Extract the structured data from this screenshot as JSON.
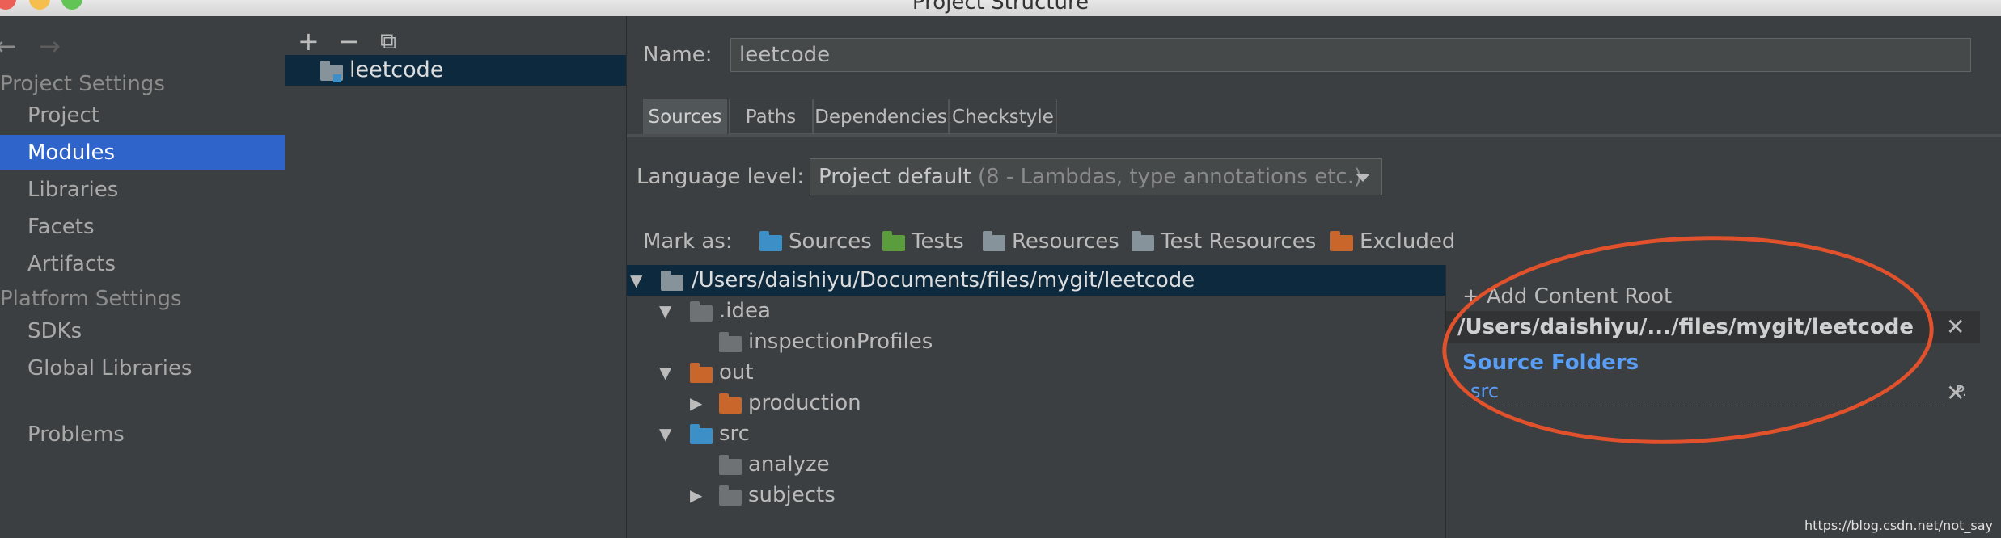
{
  "window": {
    "title": "Project Structure",
    "traffic_lights": [
      "#ec5f57",
      "#f5bf4f",
      "#61c454"
    ]
  },
  "nav": {
    "back": "←",
    "forward": "→",
    "project_settings_title": "Project Settings",
    "platform_settings_title": "Platform Settings",
    "items": {
      "project": "Project",
      "modules": "Modules",
      "libraries": "Libraries",
      "facets": "Facets",
      "artifacts": "Artifacts",
      "sdks": "SDKs",
      "global_libraries": "Global Libraries",
      "problems": "Problems"
    },
    "selected": "Modules"
  },
  "module_list": {
    "add": "+",
    "remove": "−",
    "copy": "⧉",
    "modules": [
      "leetcode"
    ]
  },
  "module_editor": {
    "name_label": "Name:",
    "name_value": "leetcode",
    "tabs": [
      "Sources",
      "Paths",
      "Dependencies",
      "Checkstyle"
    ],
    "active_tab": "Sources",
    "language_level_label": "Language level:",
    "language_level_value": "Project default",
    "language_level_hint": "(8 - Lambdas, type annotations etc.)",
    "mark_as_label": "Mark as:",
    "mark_as": [
      {
        "label": "Sources",
        "color": "#3d8fc7"
      },
      {
        "label": "Tests",
        "color": "#5b9c3c"
      },
      {
        "label": "Resources",
        "color": "#87939a"
      },
      {
        "label": "Test Resources",
        "color": "#87939a"
      },
      {
        "label": "Excluded",
        "color": "#c9662b"
      }
    ]
  },
  "tree": [
    {
      "label": "/Users/daishiyu/Documents/files/mygit/leetcode",
      "arrow": "▼",
      "color": "#87939a",
      "depth": 0,
      "selected": true
    },
    {
      "label": ".idea",
      "arrow": "▼",
      "color": "#6e7275",
      "depth": 1
    },
    {
      "label": "inspectionProfiles",
      "arrow": "",
      "color": "#6e7275",
      "depth": 2
    },
    {
      "label": "out",
      "arrow": "▼",
      "color": "#c9662b",
      "depth": 1
    },
    {
      "label": "production",
      "arrow": "▶",
      "color": "#c9662b",
      "depth": 2
    },
    {
      "label": "src",
      "arrow": "▼",
      "color": "#3d8fc7",
      "depth": 1
    },
    {
      "label": "analyze",
      "arrow": "",
      "color": "#6e7275",
      "depth": 2
    },
    {
      "label": "subjects",
      "arrow": "▶",
      "color": "#6e7275",
      "depth": 2
    }
  ],
  "content_root": {
    "add_label": "+ Add Content Root",
    "path": "/Users/daishiyu/.../files/mygit/leetcode",
    "close": "✕",
    "source_folders_title": "Source Folders",
    "source_folders": [
      "src"
    ],
    "package_prefix_icon": "P."
  },
  "watermark": "https://blog.csdn.net/not_say",
  "colors": {
    "accent_selection": "#2f65ca",
    "tree_selection": "#0d293e",
    "annotation": "#e0512c",
    "source_link": "#589df6"
  }
}
